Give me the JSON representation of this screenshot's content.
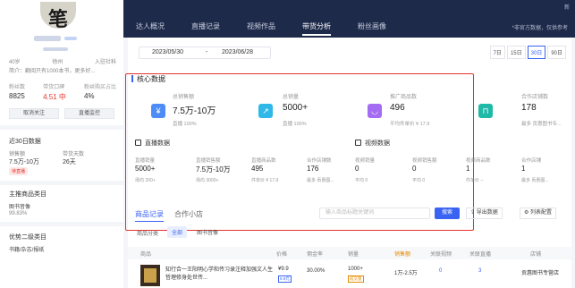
{
  "banner": {
    "tabs": [
      "达人概况",
      "直播记录",
      "视频作品",
      "带货分析",
      "粉丝画像"
    ],
    "active_tab": 3,
    "note": "*非官方数据，仅供参考",
    "corner": "新"
  },
  "profile": {
    "avatar_glyph": "笔",
    "region_row": [
      "40岁",
      "徐州",
      "入驻社科"
    ],
    "bio": "简介：翻阅只有1000本书，更多好...",
    "stats": [
      {
        "label": "粉丝数",
        "value": "8825",
        "color": ""
      },
      {
        "label": "带货口碑",
        "value": "4.51 中",
        "color": "red"
      },
      {
        "label": "粉丝购买占比",
        "value": "4%",
        "color": ""
      }
    ],
    "buttons": [
      "取消关注",
      "直播监控"
    ],
    "recent": {
      "title": "近30日数据",
      "labels": [
        "销售额",
        "带货天数"
      ],
      "values": [
        "7.5万-10万",
        "26天"
      ],
      "tag": "待直播"
    },
    "main_cat": {
      "title": "主推商品类目",
      "name": "图书音像",
      "pct": "99.83%"
    },
    "second_cat": {
      "title": "优势二级类目",
      "name": "书籍/杂志/报纸"
    }
  },
  "filters": {
    "date_start": "2023/05/30",
    "date_sep": "-",
    "date_end": "2023/06/28",
    "ranges": [
      "7日",
      "15日",
      "30日",
      "90日"
    ],
    "active_range": 2
  },
  "core": {
    "title": "核心数据",
    "kpis": [
      {
        "label": "总销售额",
        "value": "7.5万-10万",
        "sub": "直播 100%",
        "icon": "yen-icon",
        "color": "#4d8cf7",
        "glyph": "¥"
      },
      {
        "label": "总销量",
        "value": "5000+",
        "sub": "直播 100%",
        "icon": "trend-icon",
        "color": "#2fb8e8",
        "glyph": "↗"
      },
      {
        "label": "推广商品数",
        "value": "496",
        "sub": "平均件单价 ¥ 17.9",
        "icon": "smile-icon",
        "color": "#a36cf2",
        "glyph": "◡"
      },
      {
        "label": "合作店铺数",
        "value": "178",
        "sub": "最多 贡惠图书专...",
        "icon": "store-icon",
        "color": "#1fb9a8",
        "glyph": "⊓"
      }
    ]
  },
  "live": {
    "title": "直播数据",
    "cells": [
      {
        "label": "直播销量",
        "value": "5000+",
        "sub": "场均 200+"
      },
      {
        "label": "直播销售额",
        "value": "7.5万-10万",
        "sub": "场均 3000+"
      },
      {
        "label": "直播商品数",
        "value": "495",
        "sub": "件单价 ¥ 17.9"
      },
      {
        "label": "合作店铺数",
        "value": "176",
        "sub": "最多 贡惠图..."
      }
    ]
  },
  "video": {
    "title": "视频数据",
    "cells": [
      {
        "label": "视频销量",
        "value": "0",
        "sub": "平均 0"
      },
      {
        "label": "视频销售额",
        "value": "0",
        "sub": "平均 0"
      },
      {
        "label": "视频商品数",
        "value": "1",
        "sub": "件单价 --"
      },
      {
        "label": "合作店铺",
        "value": "1",
        "sub": "最多 贡惠图..."
      }
    ]
  },
  "products": {
    "tabs": [
      "商品记录",
      "合作小店"
    ],
    "search_placeholder": "输入商品标题关键词",
    "search_btn": "搜索",
    "export": "导出数据",
    "columns_cfg": "列表配置",
    "category_label": "商品分类",
    "chips": [
      "全部",
      "图书音像"
    ],
    "headers": [
      "商品",
      "价格",
      "佣金率",
      "销量",
      "销售额",
      "关联视频",
      "关联直播",
      "店铺"
    ],
    "rows": [
      {
        "title": "知行合一王阳明心学和传习录注释加强文人生哲理修身处世传...",
        "price": "¥9.9",
        "price_tag": "9.9元",
        "commission": "30.00%",
        "sales": "1000+",
        "sales_tag": "成交量",
        "revenue": "1万-2.5万",
        "videos": "0",
        "lives": "3",
        "shop": "贡惠图书专营店"
      }
    ]
  }
}
